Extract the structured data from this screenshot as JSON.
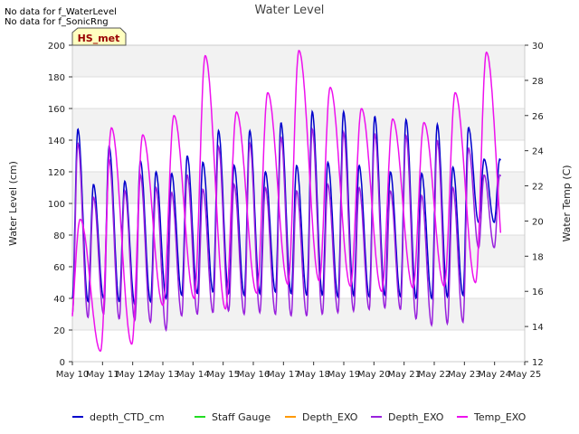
{
  "notes": [
    "No data for f_WaterLevel",
    "No data for f_SonicRng"
  ],
  "badge": "HS_met",
  "chart_data": {
    "type": "line",
    "title": "Water Level",
    "xlabel": "",
    "ylabel": "Water Level (cm)",
    "y2label": "Water Temp (C)",
    "xlim": [
      10,
      25
    ],
    "ylim": [
      0,
      200
    ],
    "y2lim": [
      12,
      30
    ],
    "x_ticks": [
      10,
      11,
      12,
      13,
      14,
      15,
      16,
      17,
      18,
      19,
      20,
      21,
      22,
      23,
      24,
      25
    ],
    "x_tick_labels": [
      "May 10",
      "May 11",
      "May 12",
      "May 13",
      "May 14",
      "May 15",
      "May 16",
      "May 17",
      "May 18",
      "May 19",
      "May 20",
      "May 21",
      "May 22",
      "May 23",
      "May 24",
      "May 25"
    ],
    "y_ticks": [
      0,
      20,
      40,
      60,
      80,
      100,
      120,
      140,
      160,
      180,
      200
    ],
    "y2_ticks": [
      12,
      14,
      16,
      18,
      20,
      22,
      24,
      26,
      28,
      30
    ],
    "grid": true,
    "legend_position": "bottom",
    "legend": [
      {
        "name": "depth_CTD_cm",
        "color": "#0000cc"
      },
      {
        "name": "Staff Gauge",
        "color": "#22dd22"
      },
      {
        "name": "Depth_EXO",
        "color": "#ff9900"
      },
      {
        "name": "Depth_EXO",
        "color": "#9922dd"
      },
      {
        "name": "Temp_EXO",
        "color": "#ee11ee"
      }
    ],
    "series": [
      {
        "name": "depth_CTD_cm",
        "axis": "left",
        "color": "#0000cc",
        "x_start": 10,
        "x_end": 24.2,
        "cycles_per_day": 1.93,
        "phase": 0.0,
        "peaks": [
          147,
          112,
          136,
          114,
          127,
          120,
          119,
          130,
          126,
          146,
          124,
          146,
          120,
          151,
          124,
          158,
          126,
          158,
          124,
          155,
          120,
          153,
          119,
          150,
          123,
          148,
          128
        ],
        "troughs": [
          40,
          38,
          40,
          38,
          36,
          38,
          40,
          42,
          43,
          44,
          43,
          42,
          43,
          44,
          43,
          42,
          42,
          41,
          42,
          41,
          42,
          41,
          40,
          40,
          41,
          42,
          88
        ]
      },
      {
        "name": "Depth_EXO",
        "axis": "left",
        "color": "#9922dd",
        "x_start": 10,
        "x_end": 24.2,
        "cycles_per_day": 1.93,
        "phase": 0.0,
        "peaks": [
          138,
          104,
          128,
          108,
          118,
          110,
          107,
          118,
          109,
          136,
          112,
          138,
          110,
          142,
          108,
          147,
          112,
          145,
          110,
          144,
          108,
          143,
          105,
          140,
          110,
          135,
          118
        ],
        "troughs": [
          30,
          28,
          30,
          27,
          26,
          25,
          20,
          29,
          30,
          31,
          32,
          30,
          31,
          30,
          29,
          29,
          30,
          31,
          32,
          33,
          34,
          33,
          27,
          23,
          24,
          25,
          72
        ]
      },
      {
        "name": "Temp_EXO",
        "axis": "right",
        "color": "#ee11ee",
        "x_start": 10,
        "x_end": 24.2,
        "cycles_per_day": 0.965,
        "phase": 0.1,
        "peaks": [
          20.1,
          25.3,
          24.9,
          26.0,
          29.4,
          26.2,
          27.3,
          29.7,
          27.6,
          26.4,
          25.8,
          25.6,
          27.3,
          29.6,
          24.9
        ],
        "troughs": [
          13.3,
          12.6,
          13.0,
          15.2,
          15.6,
          15.0,
          15.9,
          16.4,
          16.6,
          16.3,
          16.0,
          16.2,
          16.3,
          16.5,
          16.6
        ]
      }
    ]
  }
}
